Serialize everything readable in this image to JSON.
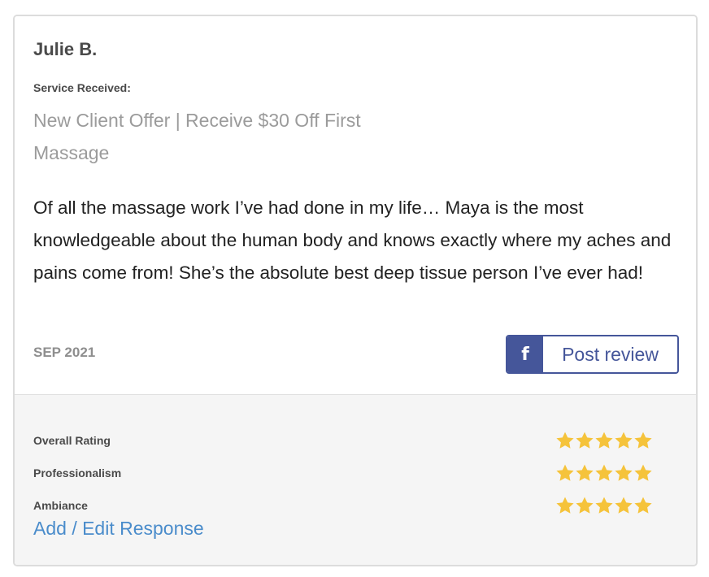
{
  "review": {
    "reviewer_name": "Julie B.",
    "service_label": "Service Received:",
    "service_name": "New Client Offer | Receive $30 Off First Massage",
    "text": "Of all the massage work I’ve had done in my life… Maya is the most knowledgeable about the human body and knows exactly where my aches and pains come from! She’s the absolute best deep tissue person I’ve ever had!",
    "date": "SEP 2021"
  },
  "facebook_button": {
    "icon": "facebook-icon",
    "icon_glyph": "f",
    "label": "Post review",
    "color": "#45569a"
  },
  "ratings": [
    {
      "label": "Overall Rating",
      "stars": 5,
      "max": 5
    },
    {
      "label": "Professionalism",
      "stars": 5,
      "max": 5
    },
    {
      "label": "Ambiance",
      "stars": 5,
      "max": 5
    }
  ],
  "response_link": "Add / Edit Response",
  "colors": {
    "star": "#f5c33b",
    "link": "#4a8ccb",
    "muted": "#9b9b9b"
  }
}
